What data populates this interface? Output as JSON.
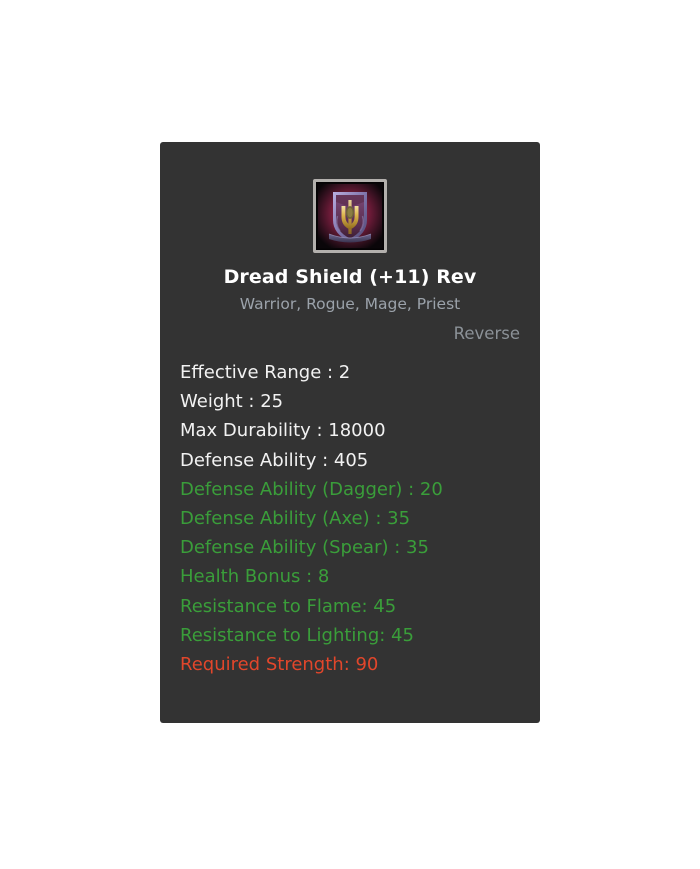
{
  "card": {
    "icon": {
      "name": "dread-shield-icon",
      "alt": "Dread Shield",
      "colors": {
        "frame": "#b3b0ad",
        "backdrop_outer": "#0b0709",
        "backdrop_glow": "#8e1d45",
        "shield_body": "#6b3a63",
        "shield_trim": "#9a8fc0",
        "emblem_gold": "#d9b34a"
      }
    },
    "title": "Dread Shield (+11) Rev",
    "classes": "Warrior, Rogue, Mage, Priest",
    "reverse_label": "Reverse",
    "stats": [
      {
        "text": "Effective Range : 2",
        "type": "base"
      },
      {
        "text": "Weight : 25",
        "type": "base"
      },
      {
        "text": "Max Durability : 18000",
        "type": "base"
      },
      {
        "text": "Defense Ability : 405",
        "type": "base"
      },
      {
        "text": "Defense Ability (Dagger) : 20",
        "type": "bonus"
      },
      {
        "text": "Defense Ability (Axe) : 35",
        "type": "bonus"
      },
      {
        "text": "Defense Ability (Spear) : 35",
        "type": "bonus"
      },
      {
        "text": "Health Bonus : 8",
        "type": "bonus"
      },
      {
        "text": "Resistance to Flame: 45",
        "type": "bonus"
      },
      {
        "text": "Resistance to Lighting: 45",
        "type": "bonus"
      },
      {
        "text": "Required Strength: 90",
        "type": "require"
      }
    ]
  },
  "theme": {
    "page_background": "#ffffff",
    "card_background": "#333333",
    "text_base": "#f2f2f2",
    "text_bonus": "#3a9e3a",
    "text_require": "#e2462b",
    "text_muted": "#9ba2aa",
    "text_reverse": "#8b9197"
  }
}
